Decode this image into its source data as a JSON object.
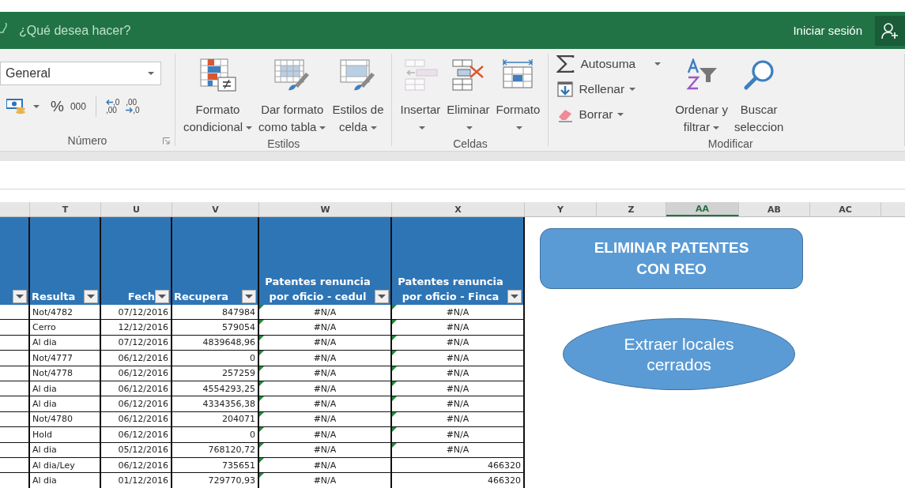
{
  "title_bar": {
    "search_hint": "¿Qué desea hacer?",
    "sign_in": "Iniciar sesión"
  },
  "ribbon": {
    "groups": [
      {
        "kind": "number",
        "label": "Número",
        "format": "General",
        "percent": "%",
        "thousands": "000",
        "decimals": [
          {
            "top": ",0",
            "bottom": ",00"
          },
          {
            "top": ",00",
            "bottom": ",0"
          }
        ]
      },
      {
        "kind": "large",
        "label": "Estilos",
        "buttons": [
          {
            "lines": [
              "Formato",
              "condicional"
            ],
            "dropdown": true,
            "disabled": false
          },
          {
            "lines": [
              "Dar formato",
              "como tabla"
            ],
            "dropdown": true,
            "disabled": false
          },
          {
            "lines": [
              "Estilos de",
              "celda"
            ],
            "dropdown": true,
            "disabled": false
          }
        ]
      },
      {
        "kind": "large",
        "label": "Celdas",
        "buttons": [
          {
            "lines": [
              "Insertar"
            ],
            "dropdown": true,
            "disabled": true
          },
          {
            "lines": [
              "Eliminar"
            ],
            "dropdown": true,
            "disabled": false
          },
          {
            "lines": [
              "Formato"
            ],
            "dropdown": true,
            "disabled": false
          }
        ]
      },
      {
        "kind": "edit",
        "label": "Modificar",
        "small": [
          {
            "label": "Autosuma",
            "dropdown": true
          },
          {
            "label": "Rellenar",
            "dropdown": true
          },
          {
            "label": "Borrar",
            "dropdown": true
          }
        ],
        "buttons": [
          {
            "lines": [
              "Ordenar y",
              "filtrar"
            ],
            "dropdown": true,
            "disabled": false
          },
          {
            "lines": [
              "Buscar",
              "seleccion"
            ],
            "dropdown": false,
            "disabled": false
          }
        ]
      }
    ]
  },
  "columns": [
    {
      "letter": "T",
      "selected": false
    },
    {
      "letter": "U",
      "selected": false
    },
    {
      "letter": "V",
      "selected": false
    },
    {
      "letter": "W",
      "selected": false
    },
    {
      "letter": "X",
      "selected": false
    },
    {
      "letter": "Y",
      "selected": false
    },
    {
      "letter": "Z",
      "selected": false
    },
    {
      "letter": "AA",
      "selected": true
    },
    {
      "letter": "AB",
      "selected": false
    },
    {
      "letter": "AC",
      "selected": false
    }
  ],
  "table": {
    "headers": [
      "Resulta",
      "Fech",
      "Recupera",
      "Patentes renuncia por oficio - cedul",
      "Patentes renuncia por oficio - Finca"
    ],
    "rows": [
      {
        "result": "Not/4782",
        "date": "07/12/2016",
        "amount": "847984",
        "w": {
          "kind": "error",
          "text": "#N/A",
          "flag": true
        },
        "x": {
          "kind": "error",
          "text": "#N/A",
          "flag": true
        }
      },
      {
        "result": "Cerro",
        "date": "12/12/2016",
        "amount": "579054",
        "w": {
          "kind": "error",
          "text": "#N/A",
          "flag": true
        },
        "x": {
          "kind": "error",
          "text": "#N/A",
          "flag": true
        }
      },
      {
        "result": "Al dia",
        "date": "07/12/2016",
        "amount": "4839648,96",
        "w": {
          "kind": "error",
          "text": "#N/A",
          "flag": true
        },
        "x": {
          "kind": "error",
          "text": "#N/A",
          "flag": true
        }
      },
      {
        "result": "Not/4777",
        "date": "06/12/2016",
        "amount": "0",
        "w": {
          "kind": "error",
          "text": "#N/A",
          "flag": true
        },
        "x": {
          "kind": "error",
          "text": "#N/A",
          "flag": true
        }
      },
      {
        "result": "Not/4778",
        "date": "06/12/2016",
        "amount": "257259",
        "w": {
          "kind": "error",
          "text": "#N/A",
          "flag": true
        },
        "x": {
          "kind": "error",
          "text": "#N/A",
          "flag": true
        }
      },
      {
        "result": "Al dia",
        "date": "06/12/2016",
        "amount": "4554293,25",
        "w": {
          "kind": "error",
          "text": "#N/A",
          "flag": true
        },
        "x": {
          "kind": "error",
          "text": "#N/A",
          "flag": true
        }
      },
      {
        "result": "Al dia",
        "date": "06/12/2016",
        "amount": "4334356,38",
        "w": {
          "kind": "error",
          "text": "#N/A",
          "flag": true
        },
        "x": {
          "kind": "error",
          "text": "#N/A",
          "flag": true
        }
      },
      {
        "result": "Not/4780",
        "date": "06/12/2016",
        "amount": "204071",
        "w": {
          "kind": "error",
          "text": "#N/A",
          "flag": true
        },
        "x": {
          "kind": "error",
          "text": "#N/A",
          "flag": true
        }
      },
      {
        "result": "Hold",
        "date": "06/12/2016",
        "amount": "0",
        "w": {
          "kind": "error",
          "text": "#N/A",
          "flag": true
        },
        "x": {
          "kind": "error",
          "text": "#N/A",
          "flag": true
        }
      },
      {
        "result": "Al dia",
        "date": "05/12/2016",
        "amount": "768120,72",
        "w": {
          "kind": "error",
          "text": "#N/A",
          "flag": true
        },
        "x": {
          "kind": "error",
          "text": "#N/A",
          "flag": true
        }
      },
      {
        "result": "Al dia/Ley",
        "date": "06/12/2016",
        "amount": "735651",
        "w": {
          "kind": "error",
          "text": "#N/A",
          "flag": true
        },
        "x": {
          "kind": "number",
          "text": "466320",
          "flag": false
        }
      },
      {
        "result": "Al dia",
        "date": "01/12/2016",
        "amount": "729770,93",
        "w": {
          "kind": "error",
          "text": "#N/A",
          "flag": true
        },
        "x": {
          "kind": "number",
          "text": "466320",
          "flag": false
        }
      }
    ]
  },
  "shapes": [
    {
      "kind": "rounded_rect",
      "text": "ELIMINAR PATENTES CON REO"
    },
    {
      "kind": "ellipse",
      "text": "Extraer locales cerrados"
    }
  ]
}
